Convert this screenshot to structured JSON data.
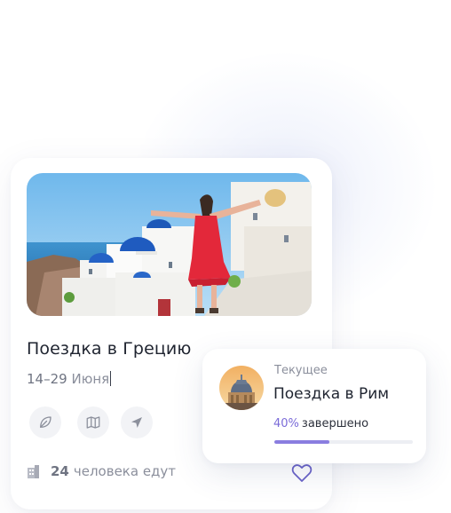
{
  "trip_card": {
    "title": "Поездка в Грецию",
    "dates_range": "14–29",
    "dates_month": "Июня",
    "actions": [
      {
        "icon": "leaf-icon"
      },
      {
        "icon": "map-icon"
      },
      {
        "icon": "send-icon"
      }
    ],
    "people_count": "24",
    "people_label": "человека едут",
    "favorite_icon": "heart-icon"
  },
  "current_trip": {
    "label": "Текущее",
    "title": "Поездка в Рим",
    "progress_percent_label": "40%",
    "progress_status": "завершено",
    "progress": 0.4
  },
  "colors": {
    "accent": "#8a7de0",
    "accent_text": "#7a6bd8",
    "heart": "#6a63c8",
    "text_primary": "#1f2430",
    "text_secondary": "#8b8f9c"
  }
}
